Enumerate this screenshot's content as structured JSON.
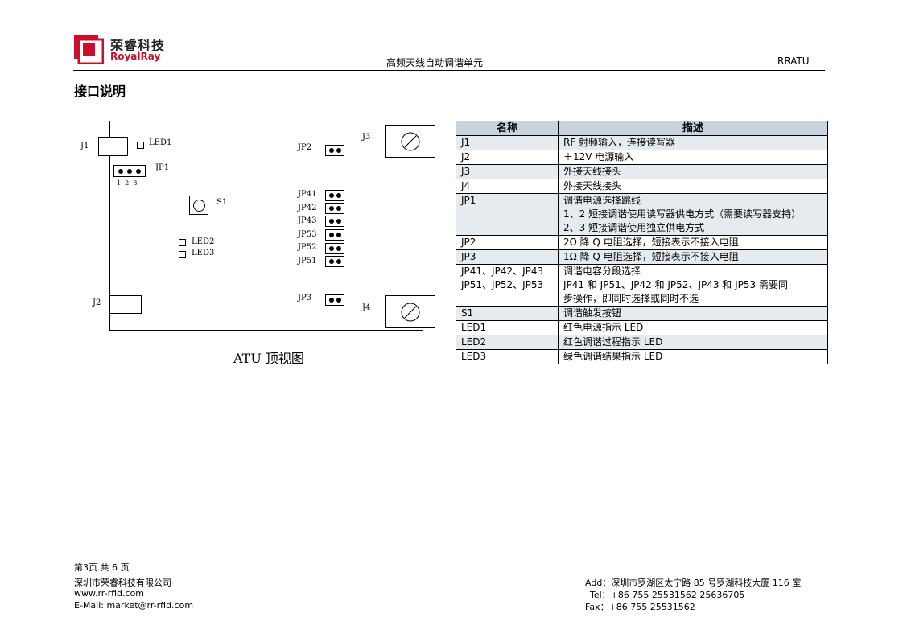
{
  "header": {
    "company_cn": "荣睿科技",
    "company_en": "RoyalRay",
    "doc_title": "高频天线自动调谐单元",
    "doc_code": "RRATU",
    "brand_color": "#c8102e"
  },
  "section_title": "接口说明",
  "board": {
    "labels": {
      "j1": "J1",
      "led1": "LED1",
      "jp1": "JP1",
      "jp1_pins": "1  2  3",
      "s1": "S1",
      "led2": "LED2",
      "led3": "LED3",
      "j2": "J2",
      "jp2": "JP2",
      "j3": "J3",
      "jp41": "JP41",
      "jp42": "JP42",
      "jp43": "JP43",
      "jp53": "JP53",
      "jp52": "JP52",
      "jp51": "JP51",
      "jp3": "JP3",
      "j4": "J4"
    },
    "caption": "ATU 顶视图"
  },
  "table": {
    "headers": [
      "名称",
      "描述"
    ],
    "rows": [
      {
        "name": [
          "J1"
        ],
        "desc": [
          "RF 射频输入，连接读写器"
        ]
      },
      {
        "name": [
          "J2"
        ],
        "desc": [
          "＋12V 电源输入"
        ]
      },
      {
        "name": [
          "J3"
        ],
        "desc": [
          "外接天线接头"
        ]
      },
      {
        "name": [
          "J4"
        ],
        "desc": [
          "外接天线接头"
        ]
      },
      {
        "name": [
          "JP1"
        ],
        "desc": [
          "调谐电源选择跳线",
          "1、2 短接调谐使用读写器供电方式（需要读写器支持）",
          "2、3 短接调谐使用独立供电方式"
        ]
      },
      {
        "name": [
          "JP2"
        ],
        "desc": [
          "2Ω 降 Q 电阻选择，短接表示不接入电阻"
        ]
      },
      {
        "name": [
          "JP3"
        ],
        "desc": [
          "1Ω 降 Q 电阻选择，短接表示不接入电阻"
        ]
      },
      {
        "name": [
          "JP41、JP42、JP43",
          "JP51、JP52、JP53"
        ],
        "desc": [
          "调谐电容分段选择",
          "JP41 和 JP51、JP42 和 JP52、JP43 和 JP53 需要同",
          "步操作，即同时选择或同时不选"
        ]
      },
      {
        "name": [
          "S1"
        ],
        "desc": [
          "调谐触发按钮"
        ]
      },
      {
        "name": [
          "LED1"
        ],
        "desc": [
          "红色电源指示 LED"
        ]
      },
      {
        "name": [
          "LED2"
        ],
        "desc": [
          "红色调谐过程指示 LED"
        ]
      },
      {
        "name": [
          "LED3"
        ],
        "desc": [
          "绿色调谐结果指示 LED"
        ]
      }
    ]
  },
  "footer": {
    "page": "第3页  共 6 页",
    "company": "深圳市荣睿科技有限公司",
    "website": "www.rr-rfid.com",
    "email": "E-Mail: market@rr-rfid.com",
    "address": "Add：深圳市罗湖区太宁路 85 号罗湖科技大厦 116 室",
    "tel": "Tel：+86 755 25531562 25636705",
    "fax": "Fax：+86 755 25531562"
  }
}
